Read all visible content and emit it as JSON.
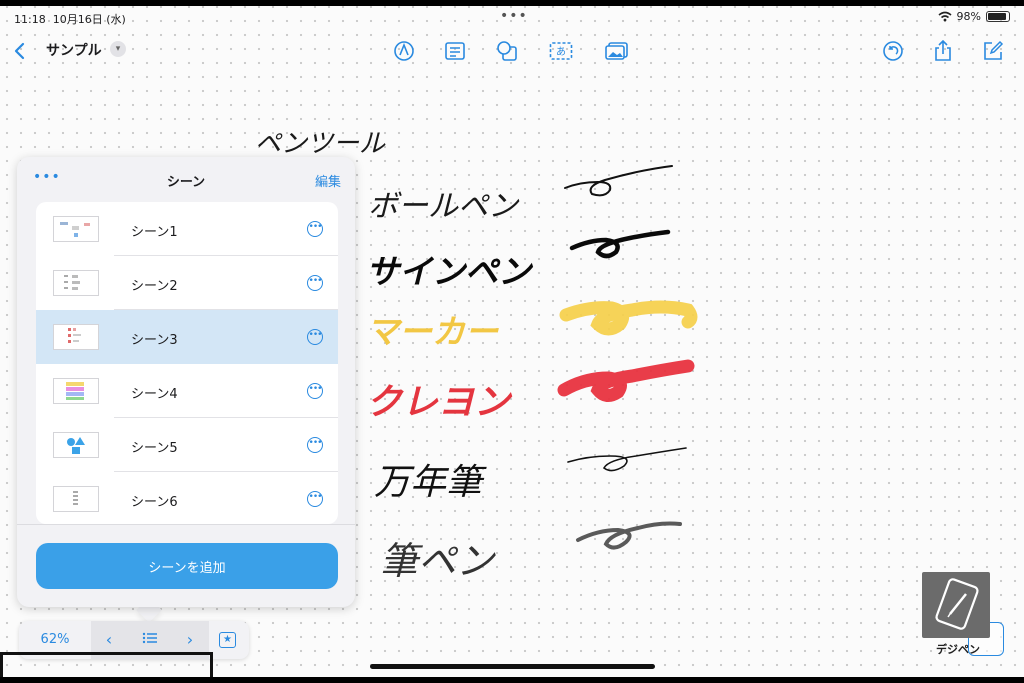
{
  "status": {
    "time": "11:18",
    "date": "10月16日 (水)",
    "battery": "98%"
  },
  "toolbar": {
    "title": "サンプル",
    "icons": [
      "back-icon",
      "pen-tool-icon",
      "text-box-icon",
      "shapes-icon",
      "text-icon",
      "media-icon",
      "undo-icon",
      "share-icon",
      "compose-icon"
    ]
  },
  "canvas": {
    "heading": "ペンツール",
    "pens": [
      "ボールペン",
      "サインペン",
      "マーカー",
      "クレヨン",
      "万年筆",
      "筆ペン"
    ],
    "colors": {
      "marker": "#f5cf4a",
      "crayon": "#e8333f",
      "ink": "#111111",
      "brush": "#5a5a5a"
    }
  },
  "scenes_panel": {
    "title": "シーン",
    "edit_label": "編集",
    "scenes": [
      {
        "label": "シーン1",
        "selected": false
      },
      {
        "label": "シーン2",
        "selected": false
      },
      {
        "label": "シーン3",
        "selected": true
      },
      {
        "label": "シーン4",
        "selected": false
      },
      {
        "label": "シーン5",
        "selected": false
      },
      {
        "label": "シーン6",
        "selected": false
      }
    ],
    "add_label": "シーンを追加"
  },
  "zoom": {
    "level": "62%"
  },
  "watermark": {
    "text": "デジペン"
  },
  "accent_color": "#2a8ae0"
}
